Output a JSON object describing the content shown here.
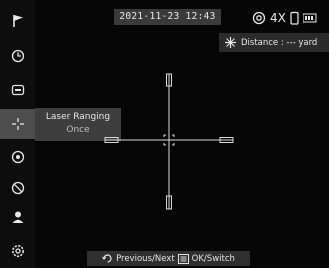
{
  "status": {
    "datetime": "2021-11-23 12:43",
    "zoom": "4X",
    "icons": [
      "target-mode-icon",
      "battery-icon",
      "signal-icon"
    ]
  },
  "distance": {
    "icon": "laser-icon",
    "text": "Distance : --- yard"
  },
  "menu": {
    "items": [
      {
        "name": "flag-icon"
      },
      {
        "name": "clock-icon"
      },
      {
        "name": "display-icon"
      },
      {
        "name": "laser-ranging-icon",
        "active": true
      },
      {
        "name": "target-icon"
      },
      {
        "name": "no-entry-icon"
      },
      {
        "name": "user-icon"
      },
      {
        "name": "settings-icon"
      }
    ],
    "popup_title": "Laser Ranging",
    "popup_value": "Once"
  },
  "hint": {
    "prev_next": "Previous/Next",
    "ok_switch": "OK/Switch"
  }
}
